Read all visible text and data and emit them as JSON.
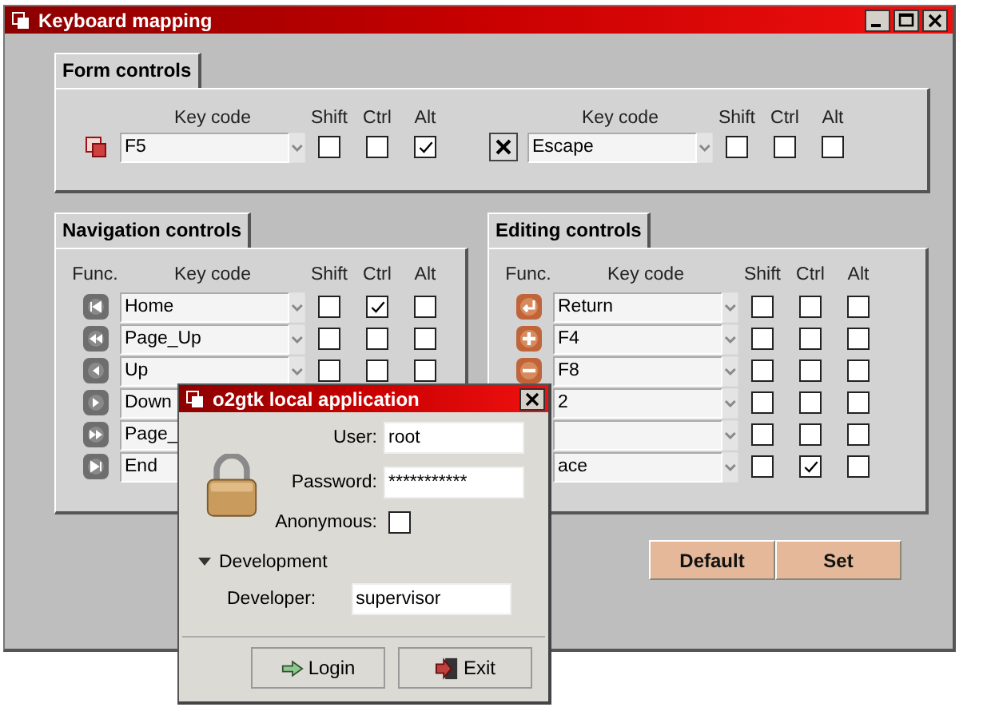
{
  "window": {
    "title": "Keyboard mapping"
  },
  "form_controls": {
    "tab": "Form controls",
    "items": [
      {
        "kind": "windows",
        "headers": [
          "Key code",
          "Shift",
          "Ctrl",
          "Alt"
        ],
        "key": "F5",
        "shift": false,
        "ctrl": false,
        "alt": true
      },
      {
        "kind": "close",
        "headers": [
          "Key code",
          "Shift",
          "Ctrl",
          "Alt"
        ],
        "key": "Escape",
        "shift": false,
        "ctrl": false,
        "alt": false
      }
    ]
  },
  "navigation": {
    "tab": "Navigation controls",
    "headers": [
      "Func.",
      "Key code",
      "Shift",
      "Ctrl",
      "Alt"
    ],
    "rows": [
      {
        "kind": "first",
        "key": "Home",
        "shift": false,
        "ctrl": true,
        "alt": false
      },
      {
        "kind": "rewind",
        "key": "Page_Up",
        "shift": false,
        "ctrl": false,
        "alt": false
      },
      {
        "kind": "back",
        "key": "Up",
        "shift": false,
        "ctrl": false,
        "alt": false
      },
      {
        "kind": "play",
        "key": "Down"
      },
      {
        "kind": "forward",
        "key": "Page_"
      },
      {
        "kind": "last",
        "key": "End"
      }
    ]
  },
  "editing": {
    "tab": "Editing controls",
    "headers": [
      "Func.",
      "Key code",
      "Shift",
      "Ctrl",
      "Alt"
    ],
    "rows": [
      {
        "kind": "enter",
        "key": "Return",
        "shift": false,
        "ctrl": false,
        "alt": false
      },
      {
        "kind": "plus",
        "key": "F4",
        "shift": false,
        "ctrl": false,
        "alt": false
      },
      {
        "kind": "minus",
        "key": "F8",
        "shift": false,
        "ctrl": false,
        "alt": false
      },
      {
        "key": "2",
        "shift": false,
        "ctrl": false,
        "alt": false
      },
      {
        "shift": false,
        "ctrl": false,
        "alt": false
      },
      {
        "key": "ace",
        "shift": false,
        "ctrl": true,
        "alt": false
      }
    ]
  },
  "buttons": [
    "Default",
    "Set"
  ],
  "dialog": {
    "title": "o2gtk local application",
    "user_label": "User:",
    "user": "root",
    "password_label": "Password:",
    "password": "***********",
    "anonymous_label": "Anonymous:",
    "anonymous": false,
    "section": "Development",
    "expanded": true,
    "developer_label": "Developer:",
    "developer": "supervisor",
    "buttons": [
      {
        "label": "Login",
        "kind": "arrow"
      },
      {
        "label": "Exit",
        "kind": "exit"
      }
    ]
  }
}
